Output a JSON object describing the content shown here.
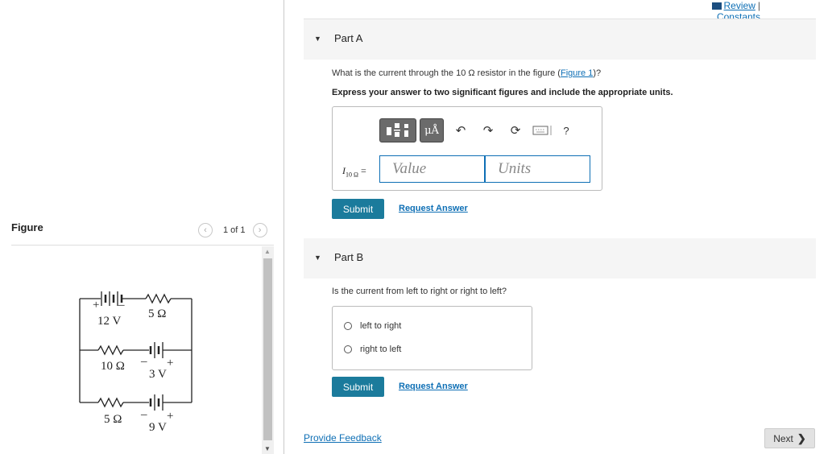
{
  "header": {
    "review_label": "Review",
    "separator": "|",
    "constants_label": "Constants"
  },
  "figure_panel": {
    "title": "Figure",
    "pager_text": "1 of 1",
    "circuit": {
      "battery_12v": "12 V",
      "resistor_5_top": "5 Ω",
      "resistor_10": "10 Ω",
      "battery_3v": "3 V",
      "resistor_5_bottom": "5 Ω",
      "battery_9v": "9 V"
    }
  },
  "part_a": {
    "title": "Part A",
    "question_prefix": "What is the current through the 10 Ω resistor in the figure (",
    "question_link": "Figure 1",
    "question_suffix": ")?",
    "instruction": "Express your answer to two significant figures and include the appropriate units.",
    "toolbar": {
      "mu_label": "μÅ",
      "help_label": "?"
    },
    "variable": "I",
    "variable_sub": "10 Ω",
    "equals": "=",
    "value_placeholder": "Value",
    "units_placeholder": "Units",
    "submit_label": "Submit",
    "request_label": "Request Answer"
  },
  "part_b": {
    "title": "Part B",
    "question": "Is the current from left to right or right to left?",
    "options": [
      "left to right",
      "right to left"
    ],
    "submit_label": "Submit",
    "request_label": "Request Answer"
  },
  "footer": {
    "feedback_label": "Provide Feedback",
    "next_label": "Next"
  },
  "colors": {
    "link": "#0e6fb5",
    "submit_bg": "#1b7b9c",
    "part_header_bg": "#f5f5f5"
  }
}
